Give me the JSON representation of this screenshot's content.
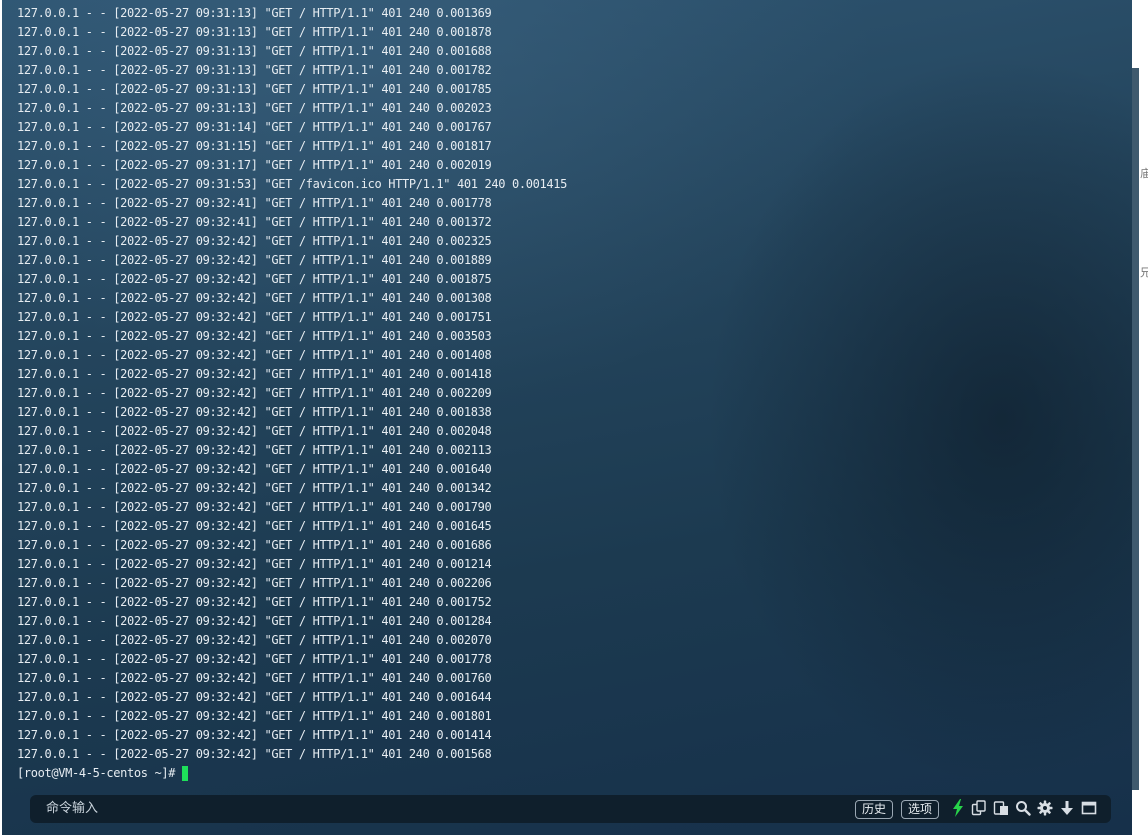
{
  "terminal": {
    "log_lines": [
      "127.0.0.1 - - [2022-05-27 09:31:13] \"GET / HTTP/1.1\" 401 240 0.001369",
      "127.0.0.1 - - [2022-05-27 09:31:13] \"GET / HTTP/1.1\" 401 240 0.001878",
      "127.0.0.1 - - [2022-05-27 09:31:13] \"GET / HTTP/1.1\" 401 240 0.001688",
      "127.0.0.1 - - [2022-05-27 09:31:13] \"GET / HTTP/1.1\" 401 240 0.001782",
      "127.0.0.1 - - [2022-05-27 09:31:13] \"GET / HTTP/1.1\" 401 240 0.001785",
      "127.0.0.1 - - [2022-05-27 09:31:13] \"GET / HTTP/1.1\" 401 240 0.002023",
      "127.0.0.1 - - [2022-05-27 09:31:14] \"GET / HTTP/1.1\" 401 240 0.001767",
      "127.0.0.1 - - [2022-05-27 09:31:15] \"GET / HTTP/1.1\" 401 240 0.001817",
      "127.0.0.1 - - [2022-05-27 09:31:17] \"GET / HTTP/1.1\" 401 240 0.002019",
      "127.0.0.1 - - [2022-05-27 09:31:53] \"GET /favicon.ico HTTP/1.1\" 401 240 0.001415",
      "127.0.0.1 - - [2022-05-27 09:32:41] \"GET / HTTP/1.1\" 401 240 0.001778",
      "127.0.0.1 - - [2022-05-27 09:32:41] \"GET / HTTP/1.1\" 401 240 0.001372",
      "127.0.0.1 - - [2022-05-27 09:32:42] \"GET / HTTP/1.1\" 401 240 0.002325",
      "127.0.0.1 - - [2022-05-27 09:32:42] \"GET / HTTP/1.1\" 401 240 0.001889",
      "127.0.0.1 - - [2022-05-27 09:32:42] \"GET / HTTP/1.1\" 401 240 0.001875",
      "127.0.0.1 - - [2022-05-27 09:32:42] \"GET / HTTP/1.1\" 401 240 0.001308",
      "127.0.0.1 - - [2022-05-27 09:32:42] \"GET / HTTP/1.1\" 401 240 0.001751",
      "127.0.0.1 - - [2022-05-27 09:32:42] \"GET / HTTP/1.1\" 401 240 0.003503",
      "127.0.0.1 - - [2022-05-27 09:32:42] \"GET / HTTP/1.1\" 401 240 0.001408",
      "127.0.0.1 - - [2022-05-27 09:32:42] \"GET / HTTP/1.1\" 401 240 0.001418",
      "127.0.0.1 - - [2022-05-27 09:32:42] \"GET / HTTP/1.1\" 401 240 0.002209",
      "127.0.0.1 - - [2022-05-27 09:32:42] \"GET / HTTP/1.1\" 401 240 0.001838",
      "127.0.0.1 - - [2022-05-27 09:32:42] \"GET / HTTP/1.1\" 401 240 0.002048",
      "127.0.0.1 - - [2022-05-27 09:32:42] \"GET / HTTP/1.1\" 401 240 0.002113",
      "127.0.0.1 - - [2022-05-27 09:32:42] \"GET / HTTP/1.1\" 401 240 0.001640",
      "127.0.0.1 - - [2022-05-27 09:32:42] \"GET / HTTP/1.1\" 401 240 0.001342",
      "127.0.0.1 - - [2022-05-27 09:32:42] \"GET / HTTP/1.1\" 401 240 0.001790",
      "127.0.0.1 - - [2022-05-27 09:32:42] \"GET / HTTP/1.1\" 401 240 0.001645",
      "127.0.0.1 - - [2022-05-27 09:32:42] \"GET / HTTP/1.1\" 401 240 0.001686",
      "127.0.0.1 - - [2022-05-27 09:32:42] \"GET / HTTP/1.1\" 401 240 0.001214",
      "127.0.0.1 - - [2022-05-27 09:32:42] \"GET / HTTP/1.1\" 401 240 0.002206",
      "127.0.0.1 - - [2022-05-27 09:32:42] \"GET / HTTP/1.1\" 401 240 0.001752",
      "127.0.0.1 - - [2022-05-27 09:32:42] \"GET / HTTP/1.1\" 401 240 0.001284",
      "127.0.0.1 - - [2022-05-27 09:32:42] \"GET / HTTP/1.1\" 401 240 0.002070",
      "127.0.0.1 - - [2022-05-27 09:32:42] \"GET / HTTP/1.1\" 401 240 0.001778",
      "127.0.0.1 - - [2022-05-27 09:32:42] \"GET / HTTP/1.1\" 401 240 0.001760",
      "127.0.0.1 - - [2022-05-27 09:32:42] \"GET / HTTP/1.1\" 401 240 0.001644",
      "127.0.0.1 - - [2022-05-27 09:32:42] \"GET / HTTP/1.1\" 401 240 0.001801",
      "127.0.0.1 - - [2022-05-27 09:32:42] \"GET / HTTP/1.1\" 401 240 0.001414",
      "127.0.0.1 - - [2022-05-27 09:32:42] \"GET / HTTP/1.1\" 401 240 0.001568"
    ],
    "prompt": "[root@VM-4-5-centos ~]#",
    "cursor_color": "#1ee05a",
    "text_color": "#e6ecf1"
  },
  "command_bar": {
    "placeholder": "命令输入",
    "history_label": "历史",
    "options_label": "选项",
    "tools": [
      {
        "icon": "lightning-icon",
        "color": "#27d34a"
      },
      {
        "icon": "copy-icon"
      },
      {
        "icon": "paste-icon"
      },
      {
        "icon": "search-icon"
      },
      {
        "icon": "gear-icon"
      },
      {
        "icon": "download-arrow-icon"
      },
      {
        "icon": "maximize-window-icon"
      }
    ]
  },
  "edge_glyphs": [
    "庙",
    "兄"
  ]
}
